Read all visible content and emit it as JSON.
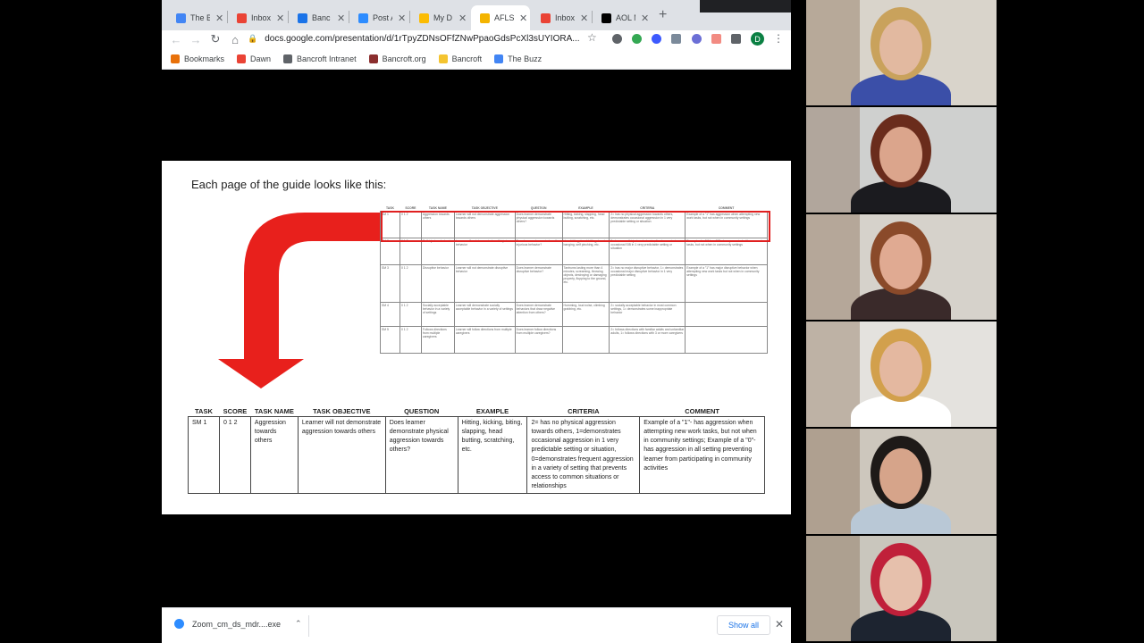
{
  "browser": {
    "tabs": [
      {
        "label": "The B",
        "icon": "docs-icon",
        "color": "#4285f4",
        "active": false
      },
      {
        "label": "Inbox",
        "icon": "gmail-icon",
        "color": "#ea4335",
        "active": false
      },
      {
        "label": "Banc",
        "icon": "calendar-icon",
        "color": "#1a73e8",
        "active": false
      },
      {
        "label": "Post A",
        "icon": "zoom-icon",
        "color": "#2d8cff",
        "active": false
      },
      {
        "label": "My D",
        "icon": "drive-icon",
        "color": "#fbbc04",
        "active": false
      },
      {
        "label": "AFLS",
        "icon": "slides-icon",
        "color": "#f4b400",
        "active": true
      },
      {
        "label": "Inbox",
        "icon": "gmail-icon",
        "color": "#ea4335",
        "active": false
      },
      {
        "label": "AOL M",
        "icon": "aol-icon",
        "color": "#000000",
        "active": false
      }
    ],
    "url": "docs.google.com/presentation/d/1rTpyZDNsOFfZNwPpaoGdsPcXl3sUYIORA...",
    "profile_initial": "D",
    "bookmarks": [
      {
        "label": "Bookmarks",
        "icon": "bookmarks-icon",
        "color": "#e8710a"
      },
      {
        "label": "Dawn",
        "icon": "gmail-icon",
        "color": "#ea4335"
      },
      {
        "label": "Bancroft Intranet",
        "icon": "globe-icon",
        "color": "#5f6368"
      },
      {
        "label": "Bancroft.org",
        "icon": "site-icon",
        "color": "#8b2e2e"
      },
      {
        "label": "Bancroft",
        "icon": "folder-icon",
        "color": "#f4c430"
      },
      {
        "label": "The Buzz",
        "icon": "docs-icon",
        "color": "#4285f4"
      }
    ]
  },
  "slide": {
    "title": "Each page of the guide looks like this:",
    "mini_table": {
      "headers": [
        "TASK",
        "SCORE",
        "TASK NAME",
        "TASK OBJECTIVE",
        "QUESTION",
        "EXAMPLE",
        "CRITERIA",
        "COMMENT"
      ],
      "rows": [
        [
          "SM 1",
          "0 1 2",
          "Aggression towards others",
          "Learner will not demonstrate aggression towards others",
          "Does learner demonstrate physical aggression towards others?",
          "Hitting, kicking, slapping, head butting, scratching, etc.",
          "2= has no physical aggression towards others, demonstrates occasional aggression in 1 very predictable setting or situation",
          "Example of a \"1\" has aggression when attempting new work tasks, but not when in community settings"
        ],
        [
          "SM 2",
          "0 1 2",
          "Self-injurious behavior",
          "Learner will not demonstrate self-injurious behavior",
          "Does learner demonstrate self-injurious behavior?",
          "Hand biting, head hitting, head banging, self pinching, etc.",
          "2= has no self-injurious behavior, 1= demonstrates occasional SIB in 1 very predictable setting or situation",
          "Example of a \"1\" has SIB when presented with new work tasks, but not when in community settings"
        ],
        [
          "SM 3",
          "0 1 2",
          "Disruptive behavior",
          "Learner will not demonstrate disruptive behavior",
          "Does learner demonstrate disruptive behavior?",
          "Tantrums lasting more than 4 minutes, screaming, throwing objects, destroying or damaging property, flopping to the ground, etc.",
          "2= has no major disruptive behavior, 1= demonstrates occasional major disruptive behavior in 1 very predictable setting",
          "Example of a \"1\" has major disruptive behavior when attempting new work tasks but not when in community settings"
        ],
        [
          "SM 4",
          "0 1 2",
          "Socially acceptable behavior in a variety of settings",
          "Learner will demonstrate socially acceptable behavior in a variety of settings",
          "Does learner demonstrate behaviors that draw negative attention from others?",
          "Humming, loud noise, climbing grabbing, etc.",
          "2= socially acceptable behavior in most common settings, 1= demonstrates some inappropriate behavior",
          ""
        ],
        [
          "SM 5",
          "0 1 2",
          "Follows directions from multiple caregivers",
          "Learner will follow directions from multiple caregivers",
          "Does learner follow directions from multiple caregivers?",
          "",
          "2= follows directions with familiar adults and unfamiliar adults, 1= follows directions with 3 or more caregivers",
          ""
        ]
      ]
    },
    "big_table": {
      "headers": [
        "TASK",
        "SCORE",
        "TASK NAME",
        "TASK OBJECTIVE",
        "QUESTION",
        "EXAMPLE",
        "CRITERIA",
        "COMMENT"
      ],
      "row": {
        "task": "SM 1",
        "score": "0  1  2",
        "task_name": "Aggression towards others",
        "task_objective": "Learner will not demonstrate aggression towards others",
        "question": "Does learner demonstrate physical aggression towards others?",
        "example": "Hitting, kicking, biting, slapping, head butting, scratching, etc.",
        "criteria": "2= has no physical aggression towards others, 1=demonstrates occasional aggression in 1 very predictable setting or situation, 0=demonstrates frequent aggression in a variety of setting that prevents access to common situations or relationships",
        "comment": "Example of a \"1\"- has aggression when attempting new work tasks, but not when in community settings; Example of a \"0\"-has aggression in all setting preventing learner from participating in community activities"
      }
    },
    "accent_color": "#e8201c"
  },
  "download_bar": {
    "filename": "Zoom_cm_ds_mdr....exe",
    "show_all_label": "Show all"
  },
  "participants": [
    {
      "wall": "#d9d4cb",
      "hair": "#c9a25c",
      "shirt": "#3b4fa8",
      "skin": "#e2b9a0"
    },
    {
      "wall": "#cfd0cf",
      "hair": "#6a2c1c",
      "shirt": "#1b1b1f",
      "skin": "#dba58c"
    },
    {
      "wall": "#d6d2cb",
      "hair": "#8a4a2a",
      "shirt": "#3a2a2a",
      "skin": "#e0aa92"
    },
    {
      "wall": "#e4e2de",
      "hair": "#d2a04c",
      "shirt": "#ffffff",
      "skin": "#e4b8a0"
    },
    {
      "wall": "#cdc7bd",
      "hair": "#1e1a18",
      "shirt": "#b9c8d6",
      "skin": "#d6a48a"
    },
    {
      "wall": "#c9c6bd",
      "hair": "#c0203a",
      "shirt": "#1d2430",
      "skin": "#e6c0ac"
    }
  ]
}
